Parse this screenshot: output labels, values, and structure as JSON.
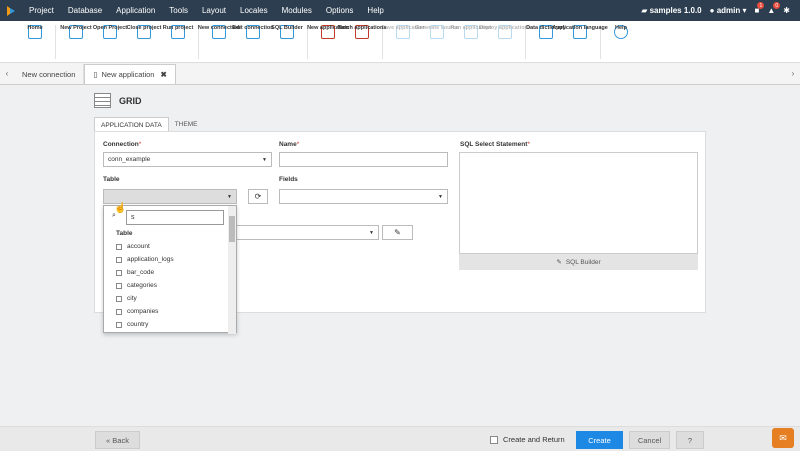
{
  "menubar": {
    "items": [
      "Project",
      "Database",
      "Application",
      "Tools",
      "Layout",
      "Locales",
      "Modules",
      "Options",
      "Help"
    ],
    "project": "samples 1.0.0",
    "user": "admin",
    "notif1": "1",
    "notif2": "0"
  },
  "toolbar": [
    {
      "label": "Home",
      "icon": "home-icon"
    },
    {
      "label": "New Project",
      "icon": "new-project-icon"
    },
    {
      "label": "Open Project",
      "icon": "folder-open-icon"
    },
    {
      "label": "Close project",
      "icon": "folder-close-icon"
    },
    {
      "label": "Run project",
      "icon": "run-icon"
    },
    {
      "label": "New connection",
      "icon": "database-icon"
    },
    {
      "label": "Edit connection",
      "icon": "edit-db-icon"
    },
    {
      "label": "SQL Builder",
      "icon": "sql-icon"
    },
    {
      "label": "New application",
      "icon": "new-app-icon"
    },
    {
      "label": "Batch applications",
      "icon": "batch-icon"
    },
    {
      "label": "Save application",
      "icon": "save-icon"
    },
    {
      "label": "Generate source",
      "icon": "generate-icon"
    },
    {
      "label": "Run application",
      "icon": "run-app-icon"
    },
    {
      "label": "Deploy applications",
      "icon": "deploy-icon"
    },
    {
      "label": "Data dictionary",
      "icon": "dictionary-icon"
    },
    {
      "label": "Application language",
      "icon": "language-icon"
    },
    {
      "label": "Help",
      "icon": "help-icon"
    }
  ],
  "tabs": {
    "tab1": "New connection",
    "tab2": "New application"
  },
  "page": {
    "title": "GRID",
    "subtab1": "APPLICATION DATA",
    "subtab2": "THEME"
  },
  "form": {
    "connection_label": "Connection",
    "connection_value": "conn_example",
    "name_label": "Name",
    "sql_label": "SQL Select Statement",
    "table_label": "Table",
    "fields_label": "Fields",
    "sql_builder": "SQL Builder"
  },
  "dropdown": {
    "search_value": "s",
    "header": "Table",
    "items": [
      "account",
      "application_logs",
      "bar_code",
      "categories",
      "city",
      "companies",
      "country"
    ]
  },
  "footer": {
    "back": "« Back",
    "create_return": "Create and Return",
    "create": "Create",
    "cancel": "Cancel",
    "help": "?"
  }
}
